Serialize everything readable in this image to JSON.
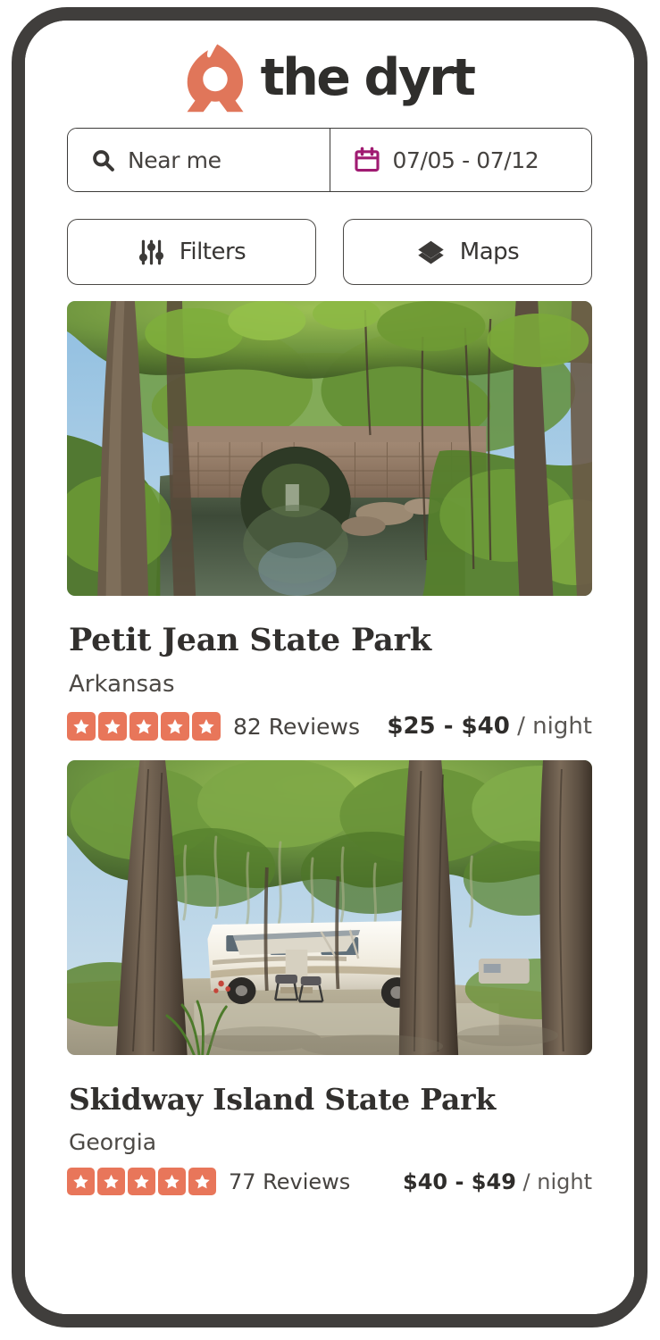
{
  "brand": {
    "name": "the dyrt",
    "logo_icon": "flame-logo-icon",
    "logo_color": "#E0765A"
  },
  "search": {
    "location_value": "Near me",
    "location_icon": "search-icon",
    "date_value": "07/05 - 07/12",
    "date_icon": "calendar-icon",
    "date_icon_color": "#A01B72"
  },
  "toolbar": {
    "filters_label": "Filters",
    "filters_icon": "sliders-icon",
    "maps_label": "Maps",
    "maps_icon": "layers-icon"
  },
  "listings": [
    {
      "title": "Petit Jean State Park",
      "region": "Arkansas",
      "rating": 5,
      "reviews_label": "82 Reviews",
      "price_range": "$25 - $40",
      "price_unit": "/ night",
      "photo_alt": "stone-arch-bridge-over-creek-in-forest"
    },
    {
      "title": "Skidway Island State Park",
      "region": "Georgia",
      "rating": 5,
      "reviews_label": "77 Reviews",
      "price_range": "$40 - $49",
      "price_unit": "/ night",
      "photo_alt": "rv-parked-under-spanish-moss-oak-trees"
    }
  ],
  "theme": {
    "star_color": "#E8765A",
    "frame_color": "#403E3C",
    "text_dark": "#32302E"
  }
}
